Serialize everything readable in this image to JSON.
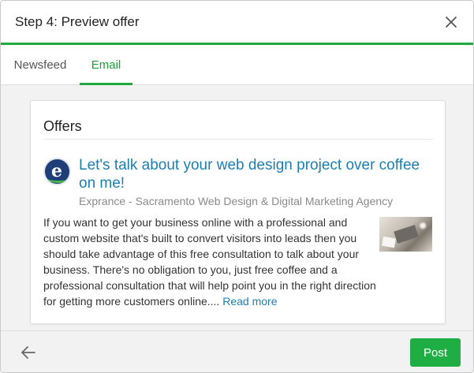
{
  "modal": {
    "title": "Step 4: Preview offer"
  },
  "tabs": [
    {
      "label": "Newsfeed",
      "active": false
    },
    {
      "label": "Email",
      "active": true
    }
  ],
  "card": {
    "heading": "Offers",
    "offer_title": "Let's talk about your web design project over coffee on me!",
    "company": "Exprance - Sacramento Web Design & Digital Marketing Agency",
    "description": "If you want to get your business online with a professional and custom website that's built to convert visitors into leads then you should take advantage of this free consultation to talk about your business. There's no obligation to you, just free coffee and a professional consultation that will help point you in the right direction for getting more customers online....",
    "read_more": "Read more",
    "logo_letter": "e"
  },
  "footer": {
    "post_label": "Post"
  },
  "icons": {
    "close": "close-icon",
    "back": "arrow-left-icon"
  },
  "colors": {
    "accent_green": "#1faa3e",
    "link_blue": "#1c7fb0"
  }
}
